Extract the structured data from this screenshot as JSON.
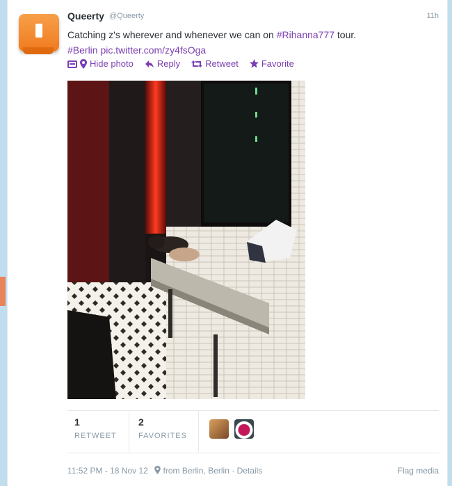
{
  "tweet": {
    "name": "Queerty",
    "handle": "@Queerty",
    "time": "11h",
    "text_plain": "Catching z's wherever and whenever we can on ",
    "hashtag_tour": "#Rihanna777",
    "text_after": " tour.",
    "hashtag_city": "#Berlin",
    "pic_link": "pic.twitter.com/zy4fsOga"
  },
  "actions": {
    "hide_photo": "Hide photo",
    "reply": "Reply",
    "retweet": "Retweet",
    "favorite": "Favorite"
  },
  "stats": {
    "retweets": "1",
    "retweets_label": "RETWEET",
    "favorites": "2",
    "favorites_label": "FAVORITES"
  },
  "footer": {
    "datetime": "11:52 PM - 18 Nov 12",
    "location": "from Berlin, Berlin",
    "separator": "·",
    "details": "Details",
    "flag_media": "Flag media"
  },
  "colors": {
    "link": "#7b3fb2",
    "avatar": "#f07a1e",
    "muted": "#8899a6"
  },
  "icons": [
    "photo-icon",
    "location-pin-icon",
    "reply-arrow-icon",
    "retweet-icon",
    "star-icon"
  ]
}
